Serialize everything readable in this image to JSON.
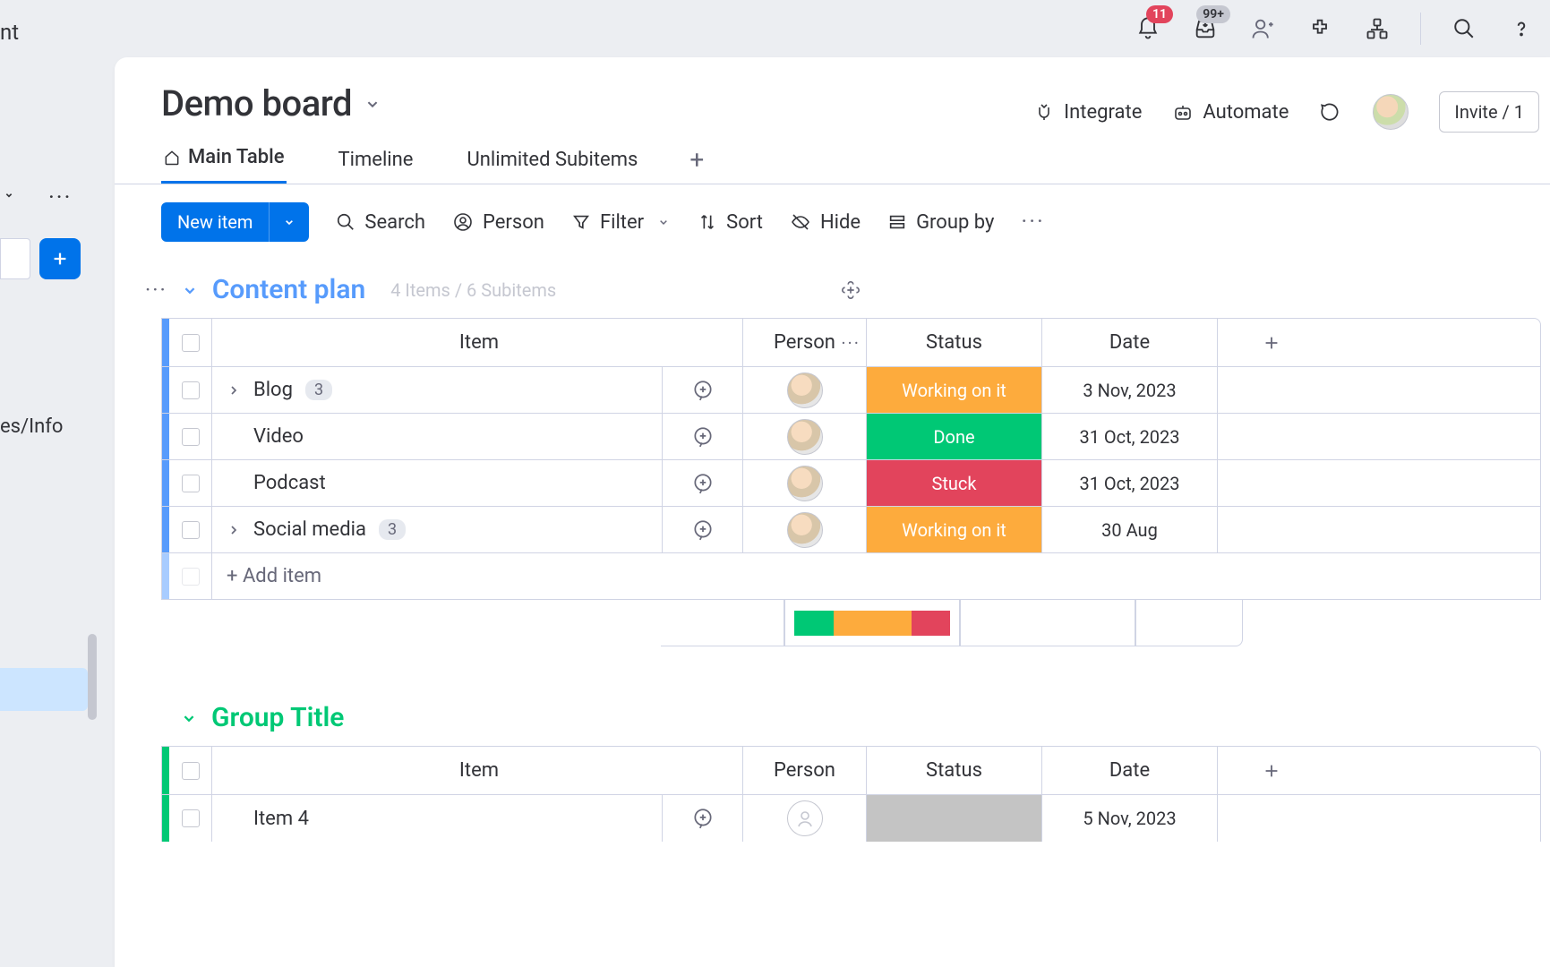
{
  "header": {
    "left_fragment": "nt",
    "notifications_badge": "11",
    "inbox_badge": "99+"
  },
  "sidebar": {
    "text_fragment": "es/Info"
  },
  "board": {
    "title": "Demo board",
    "actions": {
      "integrate": "Integrate",
      "automate": "Automate",
      "invite": "Invite / 1"
    },
    "tabs": [
      {
        "label": "Main Table",
        "active": true
      },
      {
        "label": "Timeline",
        "active": false
      },
      {
        "label": "Unlimited Subitems",
        "active": false
      }
    ],
    "toolbar": {
      "new_item": "New item",
      "search": "Search",
      "person": "Person",
      "filter": "Filter",
      "sort": "Sort",
      "hide": "Hide",
      "group_by": "Group by"
    }
  },
  "groups": [
    {
      "title": "Content plan",
      "subtitle": "4 Items / 6 Subitems",
      "color": "blue",
      "columns": {
        "item": "Item",
        "person": "Person",
        "status": "Status",
        "date": "Date"
      },
      "rows": [
        {
          "name": "Blog",
          "sub_count": "3",
          "has_subitems": true,
          "status": "Working on it",
          "status_class": "st-working",
          "date": "3 Nov, 2023"
        },
        {
          "name": "Video",
          "has_subitems": false,
          "status": "Done",
          "status_class": "st-done",
          "date": "31 Oct, 2023"
        },
        {
          "name": "Podcast",
          "has_subitems": false,
          "status": "Stuck",
          "status_class": "st-stuck",
          "date": "31 Oct, 2023"
        },
        {
          "name": "Social media",
          "sub_count": "3",
          "has_subitems": true,
          "status": "Working on it",
          "status_class": "st-working",
          "date": "30 Aug"
        }
      ],
      "add_item": "+ Add item"
    },
    {
      "title": "Group Title",
      "color": "green",
      "columns": {
        "item": "Item",
        "person": "Person",
        "status": "Status",
        "date": "Date"
      },
      "rows": [
        {
          "name": "Item 4",
          "has_subitems": false,
          "status": "",
          "status_class": "st-empty",
          "date": "5 Nov, 2023",
          "empty_person": true
        }
      ]
    }
  ]
}
